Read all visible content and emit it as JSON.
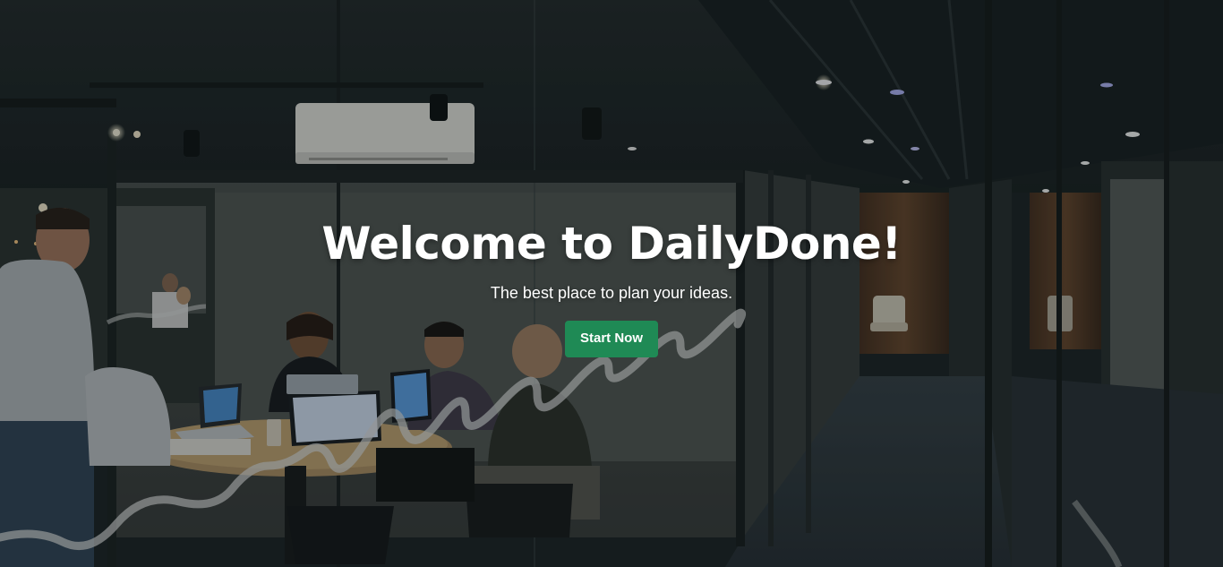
{
  "hero": {
    "title": "Welcome to DailyDone!",
    "subtitle": "The best place to plan your ideas.",
    "cta_label": "Start Now",
    "background": "office-meeting-room-photo"
  },
  "colors": {
    "cta_background": "#1f8a55",
    "text": "#ffffff"
  }
}
